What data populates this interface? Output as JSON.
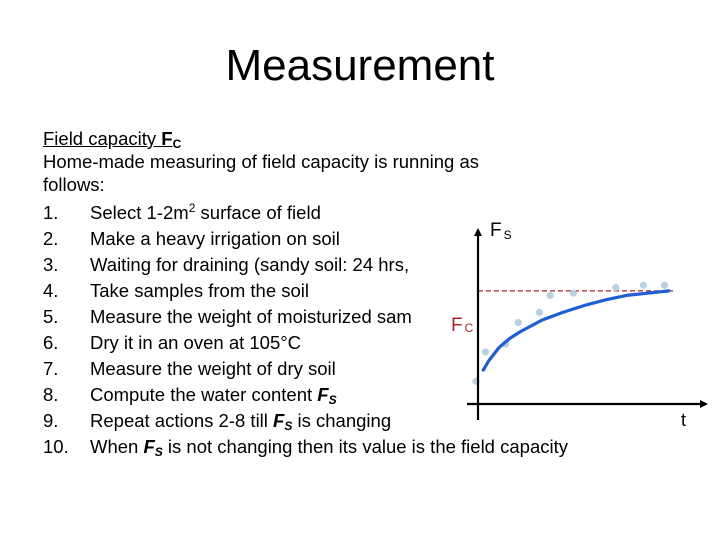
{
  "slide": {
    "title": "Measurement"
  },
  "content": {
    "heading": {
      "text": "Field capacity ",
      "symbol": "F",
      "subscript": "C"
    },
    "intro_lines": [
      "Home-made measuring of field capacity is running as",
      "follows:"
    ],
    "steps": [
      {
        "num": "1.",
        "pre": "Select 1-2m",
        "sup": "2",
        "post": " surface of field"
      },
      {
        "num": "2.",
        "text": "Make a heavy irrigation on soil"
      },
      {
        "num": "3.",
        "text": "Waiting for draining (sandy soil: 24 hrs,"
      },
      {
        "num": "4.",
        "text": "Take samples from the soil"
      },
      {
        "num": "5.",
        "text": "Measure the weight of moisturized sam"
      },
      {
        "num": "6.",
        "text": "Dry it in an oven at 105°C"
      },
      {
        "num": "7.",
        "text": "Measure the weight of dry soil"
      },
      {
        "num": "8.",
        "pre": "Compute the water content ",
        "sym": "F",
        "sub": "S",
        "post": ""
      },
      {
        "num": "9.",
        "pre": "Repeat actions 2-8 till ",
        "sym": "F",
        "sub": "S",
        "post": " is changing"
      },
      {
        "num": "10.",
        "pre": "When ",
        "sym": "F",
        "sub": "S",
        "post": " is not changing then its value is the field capacity"
      }
    ]
  },
  "chart_data": {
    "type": "line",
    "title": "",
    "ylabel": "F",
    "ylabel_sub": "S",
    "xlabel": "t",
    "reference_line": {
      "label": "F",
      "label_sub": "C",
      "value": 1.0,
      "style": "dashed"
    },
    "xlim": [
      0,
      10
    ],
    "ylim": [
      0,
      1.45
    ],
    "grid": false,
    "legend": "none",
    "series": [
      {
        "name": "fitted curve",
        "kind": "line",
        "x": [
          0.25,
          0.5,
          1,
          1.5,
          2,
          3,
          4,
          5,
          6,
          7,
          8,
          9,
          8.9
        ],
        "y": [
          0.3,
          0.38,
          0.5,
          0.58,
          0.64,
          0.74,
          0.81,
          0.87,
          0.92,
          0.96,
          0.98,
          1.0,
          1.0
        ]
      },
      {
        "name": "measurements",
        "kind": "scatter",
        "x": [
          -0.1,
          0.35,
          1.3,
          1.9,
          2.9,
          3.4,
          4.5,
          6.5,
          7.8,
          8.8
        ],
        "y": [
          0.2,
          0.46,
          0.53,
          0.72,
          0.81,
          0.96,
          0.98,
          1.03,
          1.05,
          1.05
        ]
      }
    ],
    "colors": {
      "axis": "#000000",
      "curve": "#1f5fd6",
      "points": "#b9d0e2",
      "reference": "#b0202a"
    }
  }
}
